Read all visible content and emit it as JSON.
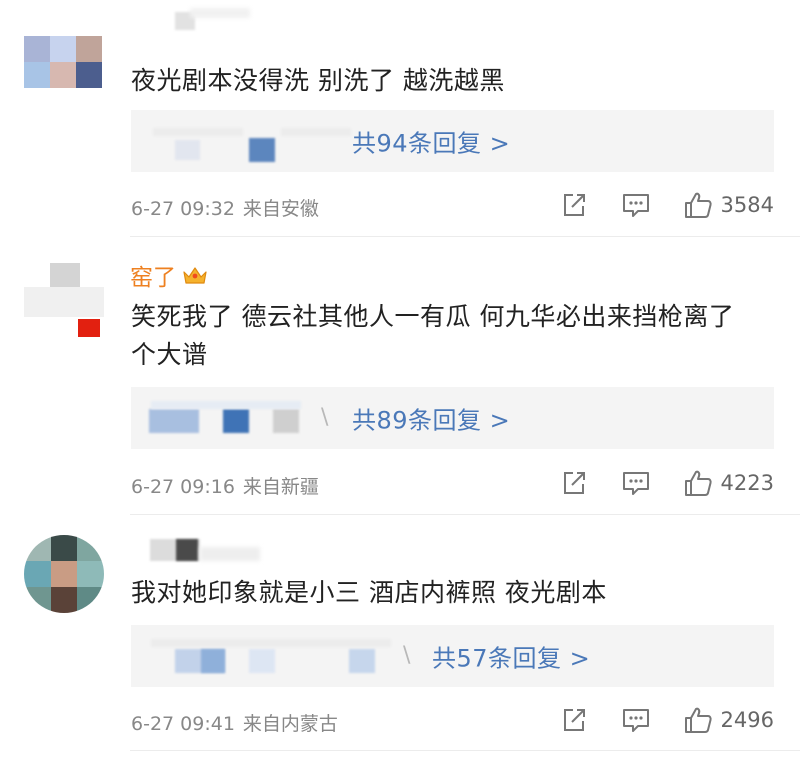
{
  "comments": [
    {
      "username": "",
      "text": "夜光剧本没得洗 别洗了 越洗越黑",
      "replies_label": "共94条回复 >",
      "date": "6-27 09:32",
      "location": "来自安徽",
      "likes": "3584"
    },
    {
      "username": "窑了",
      "text": "笑死我了 德云社其他人一有瓜 何九华必出来挡枪离了个大谱",
      "replies_label": "共89条回复 >",
      "date": "6-27 09:16",
      "location": "来自新疆",
      "likes": "4223"
    },
    {
      "username": "",
      "text": "我对她印象就是小三 酒店内裤照 夜光剧本",
      "replies_label": "共57条回复 >",
      "date": "6-27 09:41",
      "location": "来自内蒙古",
      "likes": "2496"
    }
  ],
  "icons": {
    "share": "share-icon",
    "comment": "comment-icon",
    "like": "thumbs-up-icon",
    "badge": "crown-icon"
  },
  "colors": {
    "link": "#4a78b8",
    "username": "#ee8020",
    "meta": "#888888",
    "reply_bg": "#f4f4f4"
  }
}
